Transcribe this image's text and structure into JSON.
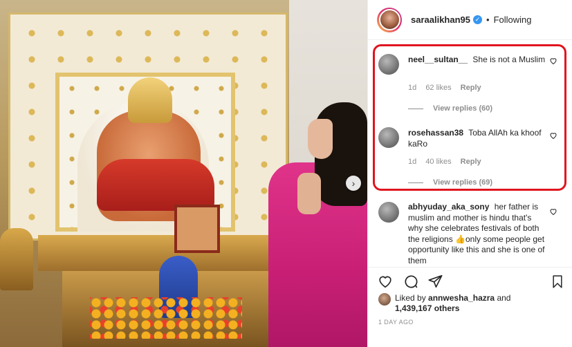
{
  "post": {
    "username": "saraalikhan95",
    "verified": true,
    "separator": "•",
    "follow_state": "Following"
  },
  "comments": [
    {
      "username": "neel__sultan__",
      "text": "She is not a Muslim",
      "age": "1d",
      "likes": "62 likes",
      "reply": "Reply",
      "view_replies": "View replies (60)"
    },
    {
      "username": "rosehassan38",
      "text": "Toba AllAh ka khoof kaRo",
      "age": "1d",
      "likes": "40 likes",
      "reply": "Reply",
      "view_replies": "View replies (69)"
    },
    {
      "username": "abhyuday_aka_sony",
      "text": "her father is muslim and mother is hindu that's why she celebrates festivals of both the religions 👍only some people get opportunity like this and she is one of them"
    }
  ],
  "likes": {
    "prefix": "Liked by",
    "user": "annwesha_hazra",
    "connector": "and",
    "others": "1,439,167 others"
  },
  "date": "1 DAY AGO",
  "icons": {
    "heart": "heart-icon",
    "comment": "comment-icon",
    "share": "share-icon",
    "save": "bookmark-icon",
    "next": "chevron-right-icon",
    "verified": "verified-badge-icon"
  },
  "colors": {
    "highlight": "#e0141e",
    "verified": "#3897f0",
    "muted": "#8e8e8e",
    "text": "#262626"
  }
}
